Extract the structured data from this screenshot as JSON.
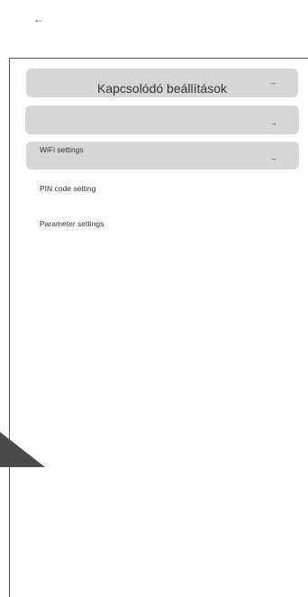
{
  "header": {
    "back_icon_glyph": "←"
  },
  "menu": {
    "row1": {
      "title": "Kapcsolódó beállítások",
      "arrow": "→"
    },
    "row2": {
      "title": "",
      "arrow": "→"
    },
    "row3": {
      "title": "WiFi settings",
      "arrow": "→"
    },
    "pin_code": "PIN code setting",
    "parameters": "Parameter settings"
  },
  "colors": {
    "row_background": "#d6d6d6",
    "panel_border": "#555555",
    "corner_triangle": "#4a4a4a"
  }
}
